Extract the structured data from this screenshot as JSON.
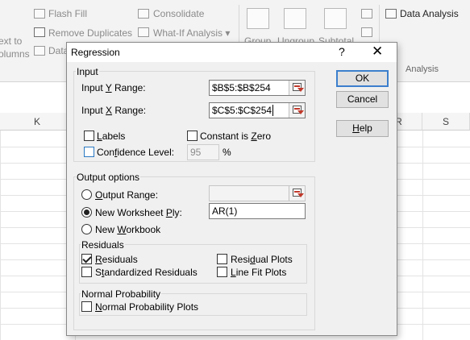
{
  "ribbon": {
    "text_to_columns_line1": "ext to",
    "text_to_columns_line2": "olumns",
    "flash_fill": "Flash Fill",
    "remove_duplicates": "Remove Duplicates",
    "data_validation": "Data",
    "consolidate": "Consolidate",
    "what_if_analysis": "What-If Analysis",
    "what_if_arrow": "▾",
    "group": "Group",
    "ungroup": "Ungroup",
    "subtotal": "Subtotal",
    "data_analysis": "Data Analysis",
    "analysis_group": "Analysis"
  },
  "sheet": {
    "columns": [
      "K",
      "R",
      "S"
    ]
  },
  "dialog": {
    "title": "Regression",
    "help_symbol": "?",
    "close_symbol": "✕",
    "input": {
      "label": "Input",
      "y_range_pre": "Input ",
      "y_range_key": "Y",
      "y_range_post": " Range:",
      "y_range_value": "$B$5:$B$254",
      "x_range_pre": "Input ",
      "x_range_key": "X",
      "x_range_post": " Range:",
      "x_range_value": "$C$5:$C$254",
      "labels_key": "L",
      "labels_rest": "abels",
      "constant_pre": "Constant is ",
      "constant_key": "Z",
      "constant_post": "ero",
      "confidence_pre": "Con",
      "confidence_key": "f",
      "confidence_post": "idence Level:",
      "confidence_value": "95",
      "percent": "%"
    },
    "output": {
      "label": "Output options",
      "output_range_key": "O",
      "output_range_rest": "utput Range:",
      "output_range_value": "",
      "new_ply_pre": "New Worksheet ",
      "new_ply_key": "P",
      "new_ply_post": "ly:",
      "new_ply_value": "AR(1)",
      "new_workbook_pre": "New ",
      "new_workbook_key": "W",
      "new_workbook_post": "orkbook",
      "selected": "new_worksheet_ply"
    },
    "residuals": {
      "label": "Residuals",
      "residuals_key": "R",
      "residuals_rest": "esiduals",
      "residuals_checked": true,
      "standardized_pre": "S",
      "standardized_key": "t",
      "standardized_post": "andardized Residuals",
      "residual_plots_pre": "Resi",
      "residual_plots_key": "d",
      "residual_plots_post": "ual Plots",
      "line_fit_key": "L",
      "line_fit_post": "ine Fit Plots"
    },
    "normal": {
      "label": "Normal Probability",
      "plots_key": "N",
      "plots_post": "ormal Probability Plots"
    },
    "buttons": {
      "ok": "OK",
      "cancel": "Cancel",
      "help_key": "H",
      "help_rest": "elp"
    }
  },
  "colors": {
    "accent": "#3c7fcd",
    "collapse_arrow": "#c0392b"
  }
}
